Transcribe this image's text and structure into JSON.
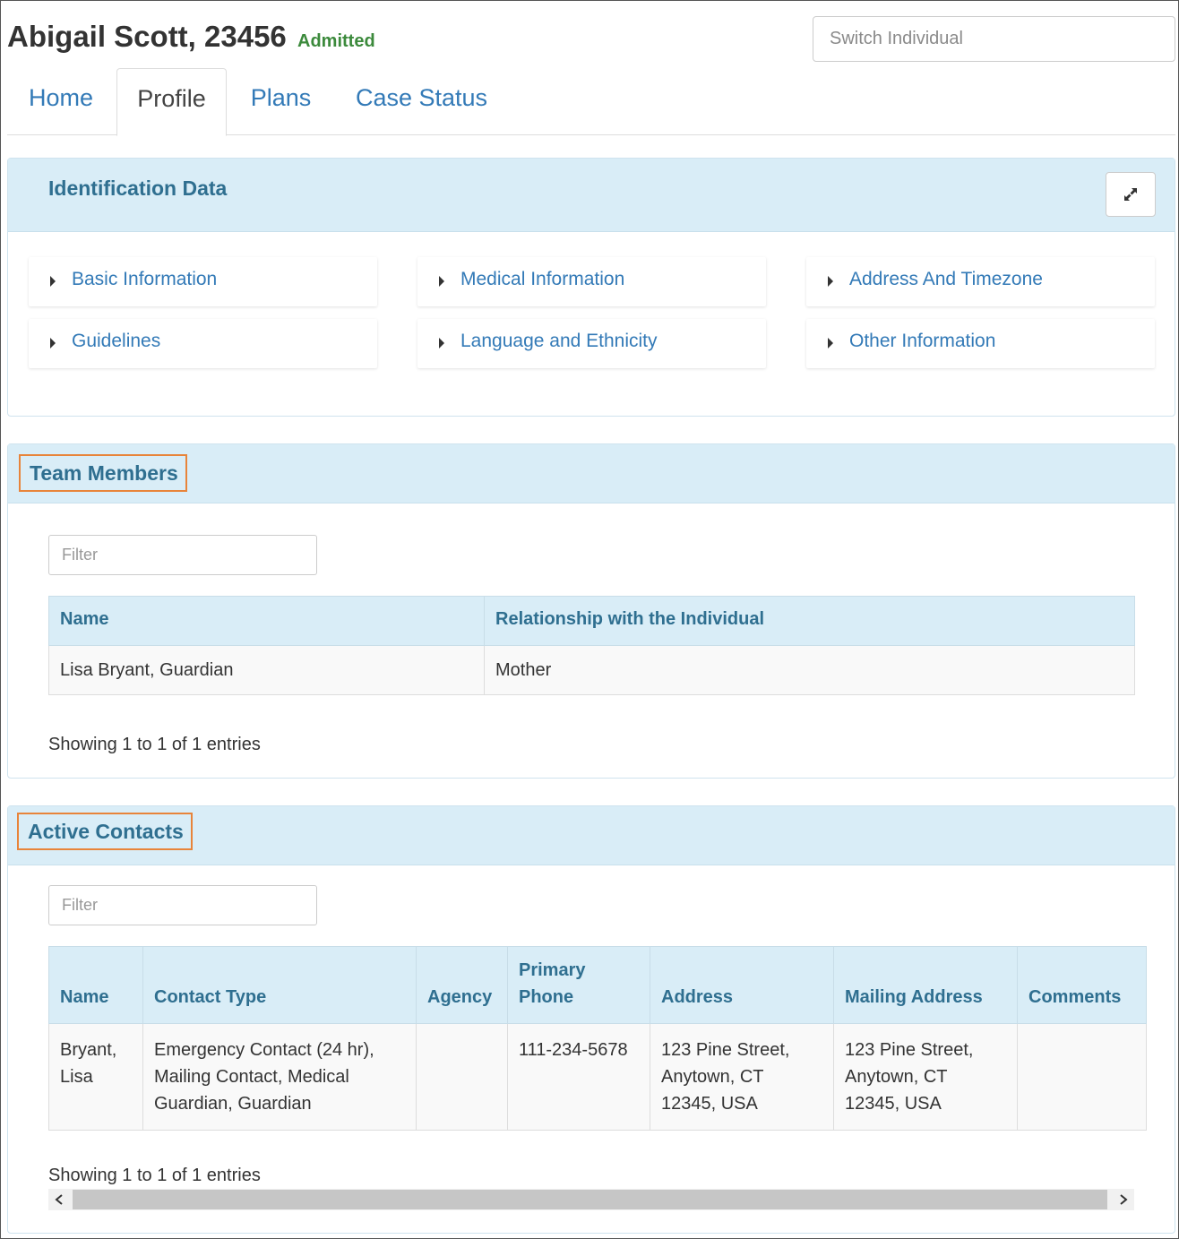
{
  "header": {
    "name": "Abigail Scott, 23456",
    "status": "Admitted",
    "switch_placeholder": "Switch Individual"
  },
  "tabs": [
    {
      "label": "Home",
      "active": false
    },
    {
      "label": "Profile",
      "active": true
    },
    {
      "label": "Plans",
      "active": false
    },
    {
      "label": "Case Status",
      "active": false
    }
  ],
  "identification": {
    "title": "Identification Data",
    "items": [
      "Basic Information",
      "Medical Information",
      "Address And Timezone",
      "Guidelines",
      "Language and Ethnicity",
      "Other Information"
    ]
  },
  "team_members": {
    "title": "Team Members",
    "filter_placeholder": "Filter",
    "columns": [
      "Name",
      "Relationship with the Individual"
    ],
    "rows": [
      [
        "Lisa Bryant, Guardian",
        "Mother"
      ]
    ],
    "info": "Showing 1 to 1 of 1 entries"
  },
  "active_contacts": {
    "title": "Active Contacts",
    "filter_placeholder": "Filter",
    "columns": [
      "Name",
      "Contact Type",
      "Agency",
      "Primary Phone",
      "Address",
      "Mailing Address",
      "Comments"
    ],
    "rows": [
      [
        "Bryant, Lisa",
        "Emergency Contact (24 hr), Mailing Contact, Medical Guardian, Guardian",
        "",
        "111-234-5678",
        "123 Pine Street, Anytown, CT 12345, USA",
        "123 Pine Street, Anytown, CT 12345, USA",
        ""
      ]
    ],
    "info": "Showing 1 to 1 of 1 entries"
  },
  "colors": {
    "accent": "#337ab7",
    "panel_heading": "#d9edf7",
    "heading_text": "#2f6f90",
    "status": "#3c8a3c",
    "highlight_outline": "#e8843a"
  },
  "icons": {
    "expand": "expand-icon",
    "scroll_left": "chevron-left-icon",
    "scroll_right": "chevron-right-icon"
  }
}
